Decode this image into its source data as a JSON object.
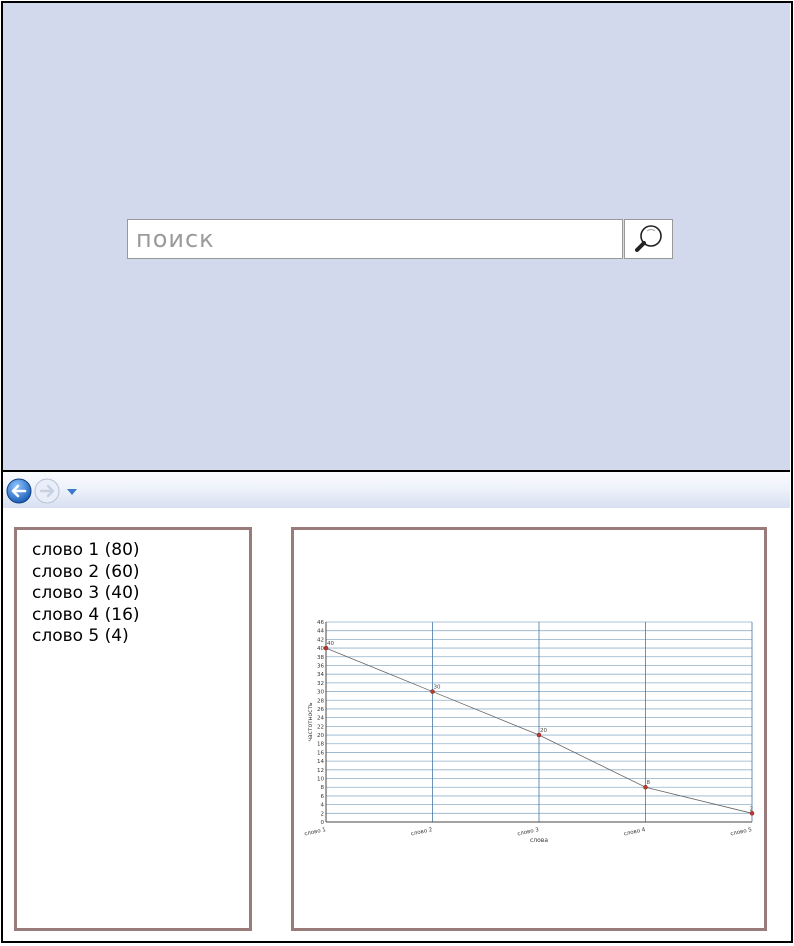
{
  "search": {
    "placeholder": "поиск"
  },
  "nav": {
    "back_icon": "back-arrow-icon",
    "forward_icon": "forward-arrow-icon",
    "dropdown_icon": "dropdown-arrow-icon"
  },
  "words": [
    {
      "label": "слово 1 (80)"
    },
    {
      "label": "слово 2 (60)"
    },
    {
      "label": "слово 3 (40)"
    },
    {
      "label": "слово 4 (16)"
    },
    {
      "label": "слово 5 (4)"
    }
  ],
  "colors": {
    "background": "#d3d9ec",
    "panel_border": "#9a7b7b",
    "grid_vertical": "#4a78a8",
    "grid_horizontal": "#8fb0cc",
    "point": "#c0392b"
  },
  "chart_data": {
    "type": "line",
    "categories": [
      "слово 1",
      "слово 2",
      "слово 3",
      "слово 4",
      "слово 5"
    ],
    "values": [
      40,
      30,
      20,
      8,
      2
    ],
    "data_labels": [
      "40",
      "30",
      "20",
      "8",
      "2"
    ],
    "yticks": [
      "0",
      "2",
      "4",
      "6",
      "8",
      "10",
      "12",
      "14",
      "16",
      "18",
      "20",
      "22",
      "24",
      "26",
      "28",
      "30",
      "32",
      "34",
      "36",
      "38",
      "40",
      "42",
      "44",
      "46"
    ],
    "ylim": [
      0,
      46
    ],
    "xlabel": "слова",
    "ylabel": "частотность",
    "grid": true
  }
}
